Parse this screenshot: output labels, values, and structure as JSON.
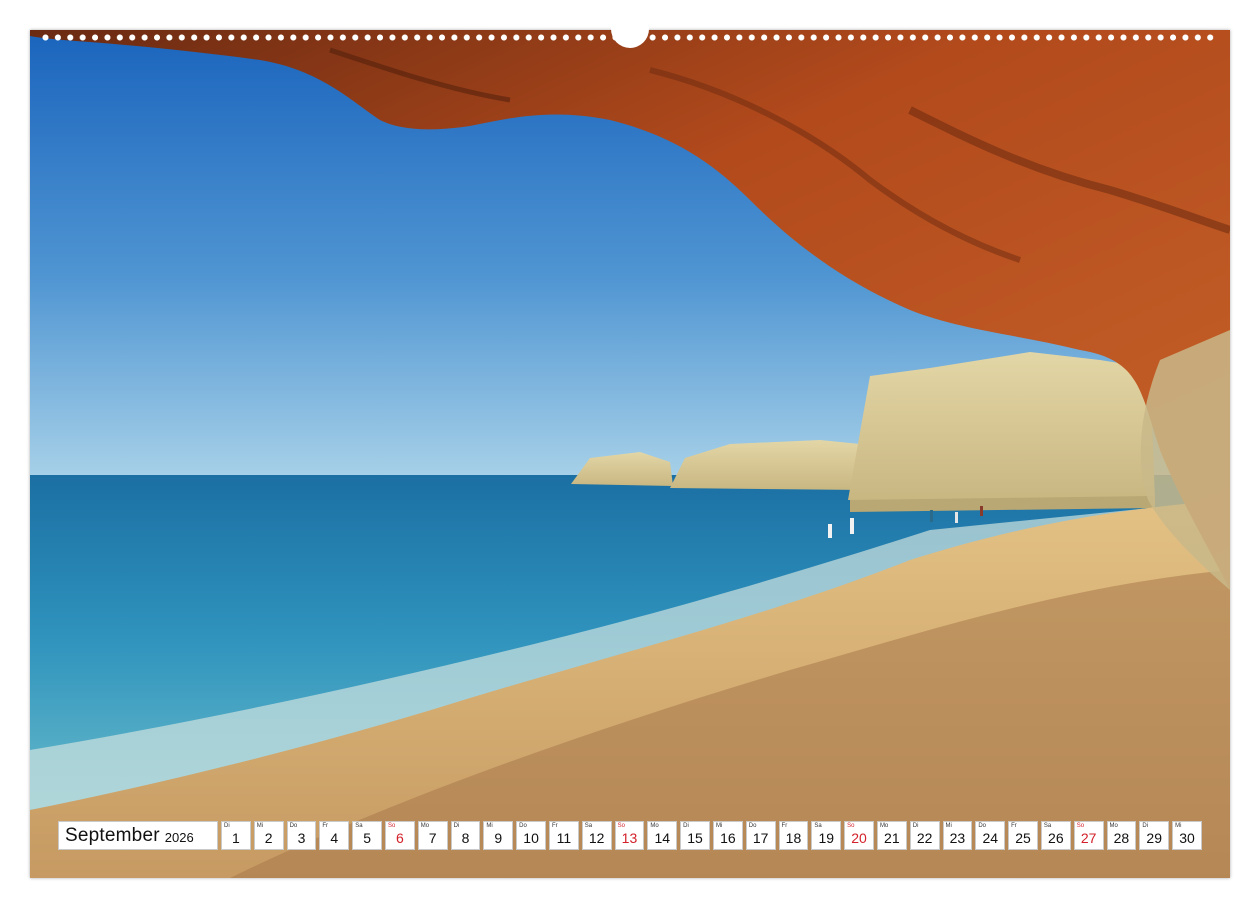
{
  "calendar": {
    "month": "September",
    "year": "2026",
    "days": [
      {
        "wd": "Di",
        "num": "1"
      },
      {
        "wd": "Mi",
        "num": "2"
      },
      {
        "wd": "Do",
        "num": "3"
      },
      {
        "wd": "Fr",
        "num": "4"
      },
      {
        "wd": "Sa",
        "num": "5"
      },
      {
        "wd": "So",
        "num": "6",
        "sunday": true
      },
      {
        "wd": "Mo",
        "num": "7"
      },
      {
        "wd": "Di",
        "num": "8"
      },
      {
        "wd": "Mi",
        "num": "9"
      },
      {
        "wd": "Do",
        "num": "10"
      },
      {
        "wd": "Fr",
        "num": "11"
      },
      {
        "wd": "Sa",
        "num": "12"
      },
      {
        "wd": "So",
        "num": "13",
        "sunday": true
      },
      {
        "wd": "Mo",
        "num": "14"
      },
      {
        "wd": "Di",
        "num": "15"
      },
      {
        "wd": "Mi",
        "num": "16"
      },
      {
        "wd": "Do",
        "num": "17"
      },
      {
        "wd": "Fr",
        "num": "18"
      },
      {
        "wd": "Sa",
        "num": "19"
      },
      {
        "wd": "So",
        "num": "20",
        "sunday": true
      },
      {
        "wd": "Mo",
        "num": "21"
      },
      {
        "wd": "Di",
        "num": "22"
      },
      {
        "wd": "Mi",
        "num": "23"
      },
      {
        "wd": "Do",
        "num": "24"
      },
      {
        "wd": "Fr",
        "num": "25"
      },
      {
        "wd": "Sa",
        "num": "26"
      },
      {
        "wd": "So",
        "num": "27",
        "sunday": true
      },
      {
        "wd": "Mo",
        "num": "28"
      },
      {
        "wd": "Di",
        "num": "29"
      },
      {
        "wd": "Mi",
        "num": "30"
      }
    ]
  },
  "colors": {
    "sunday_red": "#d3202a",
    "sky_top": "#1f6fc4",
    "sky_horizon": "#9ccbe6",
    "sea": "#2f8fb8",
    "sand": "#d8b47a",
    "cave_rock": "#a8461c",
    "cliff": "#d9cc9a"
  }
}
